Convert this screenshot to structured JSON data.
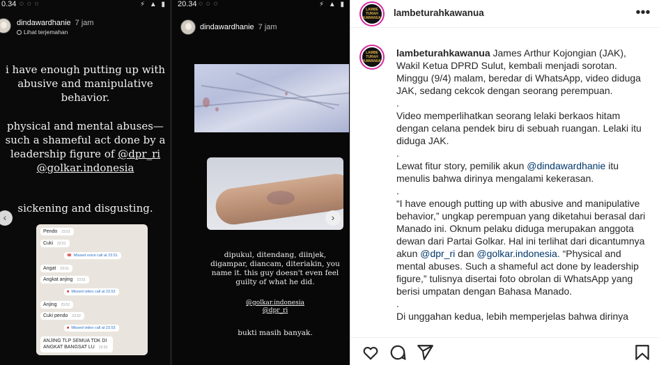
{
  "story_left": {
    "status_time": "0.34",
    "status_icons": "⚡ ▲ ▮",
    "status_apps": "◌ ◌ ◌",
    "username": "dindawardhanie",
    "time_ago": "7 jam",
    "translate": "Lihat terjemahan",
    "text_1": "i have enough putting up with abusive and manipulative behavior.",
    "text_2_pre": "physical and mental abuses— such a shameful act done by a leadership figure of",
    "mention_1": "@dpr_ri",
    "mention_2": "@golkar.indonesia",
    "text_3": "sickening and disgusting.",
    "chat": [
      {
        "text": "Pendo",
        "time": "23.51"
      },
      {
        "text": "Cuki",
        "time": "23.51"
      },
      {
        "text": "Missed voice call at 23.51",
        "call": true
      },
      {
        "text": "Angat",
        "time": "23.51"
      },
      {
        "text": "Angkat anjing",
        "time": "23.51"
      },
      {
        "text": "Missed video call at 23.52",
        "call": true
      },
      {
        "text": "Anjing",
        "time": "23.52"
      },
      {
        "text": "Cuki pendo",
        "time": "23.52"
      },
      {
        "text": "Missed video call at 23.53",
        "call": true
      },
      {
        "text": "ANJING TLP SEMUA TDK DI ANGKAT BANGSAT LU",
        "time": "23.53"
      }
    ],
    "prev_arrow": "‹"
  },
  "story_right": {
    "status_time": "20.34",
    "status_icons": "⚡ ▲ ▮",
    "status_apps": "◌ ◌ ◌",
    "username": "dindawardhanie",
    "time_ago": "7 jam",
    "text_1": "dipukul, ditendang, diinjek, digampar, diancam, diteriakin, you name it. this guy doesn't even feel guilty of what he did.",
    "mention_1": "@golkar.indonesia",
    "mention_2": "@dpr_ri",
    "text_2": "bukti masih banyak.",
    "next_arrow": "›"
  },
  "post": {
    "account": "lambeturahkawanua",
    "avatar_text": "LAMBE TURAH KAWANUA",
    "more_label": "•••",
    "caption": {
      "username": "lambeturahkawanua",
      "p1": "James Arthur Kojongian (JAK), Wakil Ketua DPRD Sulut, kembali menjadi sorotan. Minggu (9/4) malam, beredar di WhatsApp, video diduga JAK, sedang cekcok dengan seorang perempuan.",
      "dot": ".",
      "p2": "Video memperlihatkan seorang lelaki berkaos hitam dengan celana pendek biru di sebuah ruangan. Lelaki itu diduga JAK.",
      "p3_pre": "Lewat fitur story, pemilik akun",
      "p3_link": "@dindawardhanie",
      "p3_post": "itu menulis bahwa dirinya mengalami kekerasan.",
      "p4_pre": "“I have enough putting up with abusive and manipulative behavior,” ungkap perempuan yang diketahui berasal dari Manado ini. Oknum pelaku diduga merupakan anggota dewan dari Partai Golkar. Hal ini terlihat dari dicantumnya akun",
      "p4_link1": "@dpr_ri",
      "p4_mid": "dan",
      "p4_link2": "@golkar.indonesia",
      "p4_post": ". “Physical and mental abuses. Such a shameful act done by leadership figure,” tulisnya disertai foto obrolan di WhatsApp yang berisi umpatan dengan Bahasa Manado.",
      "p5": "Di unggahan kedua, lebih memperjelas bahwa dirinya"
    }
  },
  "icons": {
    "like": "heart-icon",
    "comment": "comment-icon",
    "share": "share-icon",
    "save": "bookmark-icon"
  }
}
